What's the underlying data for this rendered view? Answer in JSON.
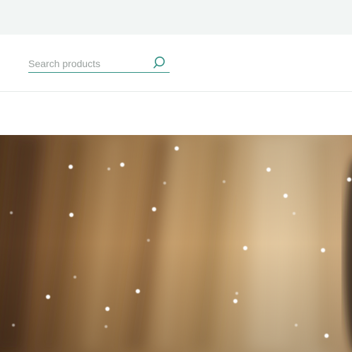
{
  "search": {
    "placeholder": "Search products"
  },
  "icons": {
    "search_button": "search-icon"
  },
  "colors": {
    "top_band": "#f2f5f4",
    "accent": "#2f8f83",
    "placeholder": "#9aa09e",
    "divider": "#e6e9e8"
  }
}
